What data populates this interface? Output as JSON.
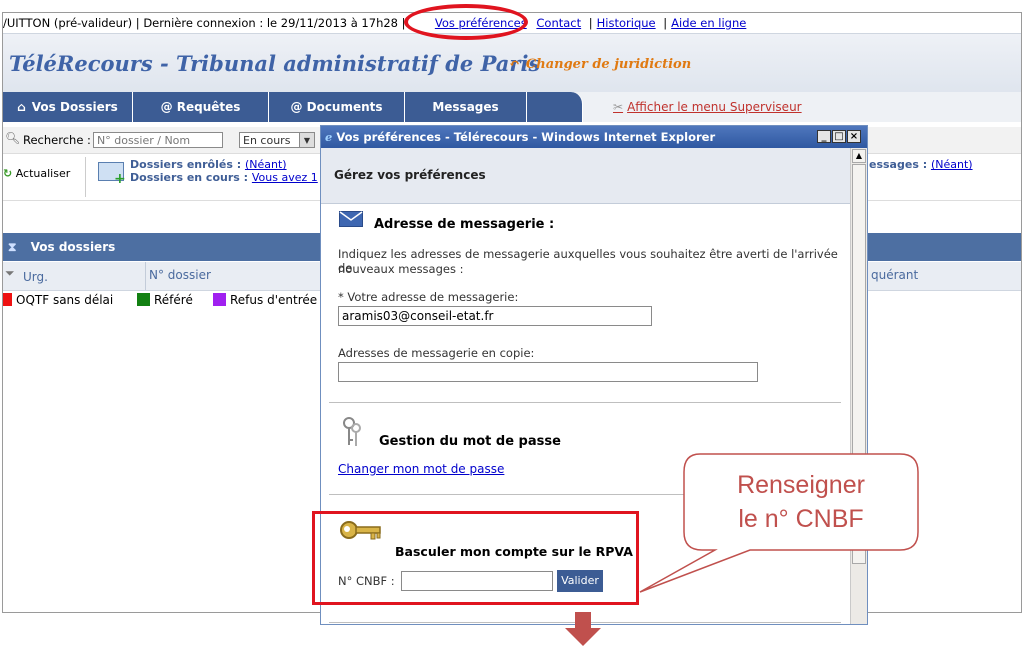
{
  "topbar": {
    "user_info": "/UITTON (pré-valideur) | Dernière connexion : le 29/11/2013 à 17h28 |",
    "links": [
      "Vos préférences",
      "Contact",
      "Historique",
      "Aide en ligne"
    ]
  },
  "header": {
    "title": "TéléRecours - Tribunal administratif de Paris",
    "change_juris": "Changer de juridiction"
  },
  "nav": {
    "tabs": [
      "Vos Dossiers",
      "@ Requêtes",
      "@ Documents",
      "Messages"
    ],
    "superviseur": "Afficher le menu Superviseur"
  },
  "search": {
    "label": "Recherche :",
    "placeholder": "N° dossier / Nom",
    "status_value": "En cours"
  },
  "info": {
    "refresh": "Actualiser",
    "enroles_label": "Dossiers enrôlés :",
    "enroles_value": "(Néant)",
    "en_cours_label": "Dossiers en cours :",
    "en_cours_value": "Vous avez 1",
    "messages_label": "essages :",
    "messages_value": "(Néant)"
  },
  "dossiers": {
    "title": "Vos dossiers",
    "columns": [
      "Urg.",
      "N° dossier",
      "quérant"
    ],
    "legend": [
      {
        "label": "OQTF sans délai",
        "color": "#ee1111"
      },
      {
        "label": "Référé",
        "color": "#128012"
      },
      {
        "label": "Refus d'entrée",
        "color": "#a020f0"
      }
    ]
  },
  "popup": {
    "window_title": "Vos préférences - Télérecours - Windows Internet Explorer",
    "heading": "Gérez vos préférences",
    "mail_section": {
      "title": "Adresse de messagerie :",
      "description_line1": "Indiquez les adresses de messagerie auxquelles vous souhaitez être averti de l'arrivée de",
      "description_line2": "nouveaux messages :",
      "email_label": "* Votre adresse de messagerie:",
      "email_value": "aramis03@conseil-etat.fr",
      "cc_label": "Adresses de messagerie en copie:",
      "cc_value": ""
    },
    "password_section": {
      "title": "Gestion du mot de passe",
      "link": "Changer mon mot de passe"
    },
    "rpva_section": {
      "title": "Basculer mon compte sur le RPVA",
      "cnbf_label": "N° CNBF :",
      "cnbf_value": "",
      "button": "Valider"
    }
  },
  "callout": {
    "line1": "Renseigner",
    "line2": "le n° CNBF"
  }
}
